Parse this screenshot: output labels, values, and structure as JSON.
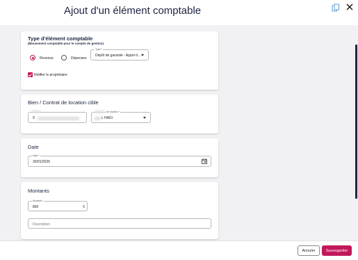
{
  "header": {
    "title": "Ajout d'un élément comptable",
    "copy_icon": "copy-icon",
    "close_icon": "close-icon"
  },
  "type_card": {
    "title": "Type d'élément comptable",
    "subtitle": "(Mouvement comptable pour le compte de gestion)",
    "radio_revenus": "Revenus",
    "radio_depenses": "Dépenses",
    "selected_radio": "Revenus",
    "type_label": "Type *",
    "type_value": "Dépôt de garantie - Appel d...",
    "notify_label": "Notifier le propriétaire",
    "notify_checked": true
  },
  "bien_card": {
    "title": "Bien / Contrat de location cible",
    "bien_value": "9",
    "contrat_label": "de location *",
    "contrat_value": "L HADI"
  },
  "date_card": {
    "title": "Date",
    "date_label": "Date *",
    "date_value": "30/01/2026"
  },
  "montants_card": {
    "title": "Montants",
    "montant_label": "Montant *",
    "montant_value": "850",
    "description_placeholder": "Description"
  },
  "footer": {
    "cancel_label": "Annuler",
    "save_label": "Sauvegarder"
  },
  "colors": {
    "accent": "#c2185b",
    "title_text": "#1d2440",
    "background": "#f1f1f3"
  }
}
